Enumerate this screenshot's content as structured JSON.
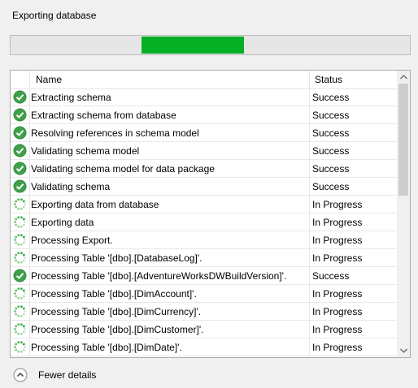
{
  "title": "Exporting database",
  "progress": {
    "segment_start": 0.328,
    "segment_end": 0.585,
    "color": "#06b025"
  },
  "table": {
    "columns": {
      "name": "Name",
      "status": "Status"
    },
    "rows": [
      {
        "name": "Extracting schema",
        "status": "Success",
        "icon": "success-check-icon"
      },
      {
        "name": "Extracting schema from database",
        "status": "Success",
        "icon": "success-check-icon"
      },
      {
        "name": "Resolving references in schema model",
        "status": "Success",
        "icon": "success-check-icon"
      },
      {
        "name": "Validating schema model",
        "status": "Success",
        "icon": "success-check-icon"
      },
      {
        "name": "Validating schema model for data package",
        "status": "Success",
        "icon": "success-check-icon"
      },
      {
        "name": "Validating schema",
        "status": "Success",
        "icon": "success-check-icon"
      },
      {
        "name": "Exporting data from database",
        "status": "In Progress",
        "icon": "in-progress-spinner-icon"
      },
      {
        "name": "Exporting data",
        "status": "In Progress",
        "icon": "in-progress-spinner-icon"
      },
      {
        "name": "Processing Export.",
        "status": "In Progress",
        "icon": "in-progress-spinner-icon"
      },
      {
        "name": "Processing Table '[dbo].[DatabaseLog]'.",
        "status": "In Progress",
        "icon": "in-progress-spinner-icon"
      },
      {
        "name": "Processing Table '[dbo].[AdventureWorksDWBuildVersion]'.",
        "status": "Success",
        "icon": "success-check-icon"
      },
      {
        "name": "Processing Table '[dbo].[DimAccount]'.",
        "status": "In Progress",
        "icon": "in-progress-spinner-icon"
      },
      {
        "name": "Processing Table '[dbo].[DimCurrency]'.",
        "status": "In Progress",
        "icon": "in-progress-spinner-icon"
      },
      {
        "name": "Processing Table '[dbo].[DimCustomer]'.",
        "status": "In Progress",
        "icon": "in-progress-spinner-icon"
      },
      {
        "name": "Processing Table '[dbo].[DimDate]'.",
        "status": "In Progress",
        "icon": "in-progress-spinner-icon"
      }
    ]
  },
  "scroll": {
    "position": 0.0,
    "visible_fraction": 0.43
  },
  "details_toggle": {
    "label": "Fewer details",
    "icon": "collapse-up-icon"
  },
  "colors": {
    "success": "#3ea14a",
    "spinner": "#2aa835"
  }
}
